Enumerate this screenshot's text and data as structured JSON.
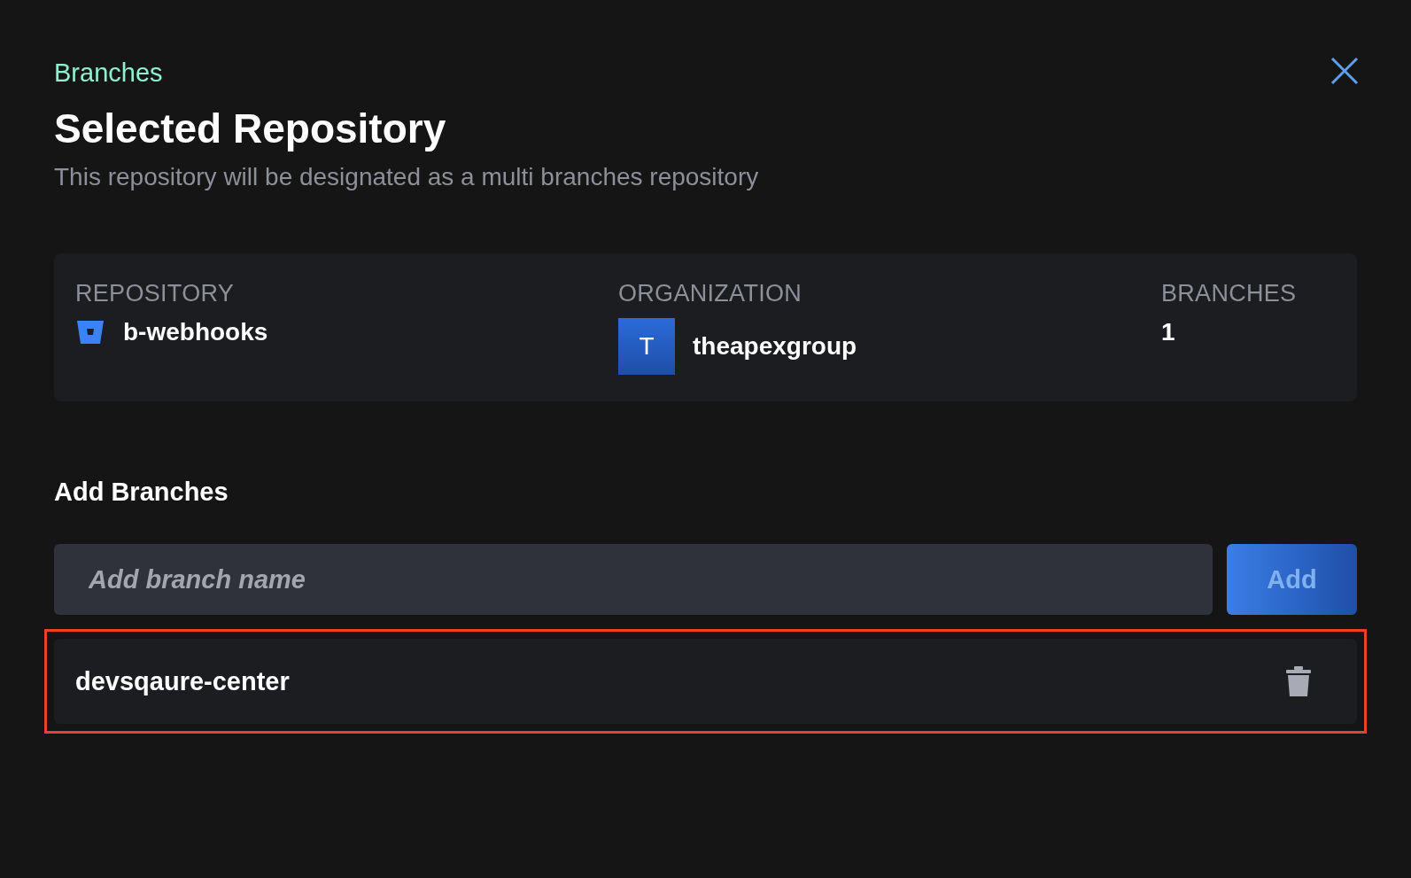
{
  "dialog": {
    "eyebrow": "Branches",
    "title": "Selected Repository",
    "subtitle": "This repository will be designated as a multi branches repository"
  },
  "summary": {
    "repository": {
      "label": "REPOSITORY",
      "value": "b-webhooks"
    },
    "organization": {
      "label": "ORGANIZATION",
      "avatar": "T",
      "value": "theapexgroup"
    },
    "branches": {
      "label": "BRANCHES",
      "value": "1"
    }
  },
  "add_branches": {
    "heading": "Add Branches",
    "placeholder": "Add branch name",
    "button": {
      "label": "Add",
      "disabled": true
    }
  },
  "branch_list": [
    {
      "name": "devsqaure-center",
      "highlighted": true
    }
  ]
}
